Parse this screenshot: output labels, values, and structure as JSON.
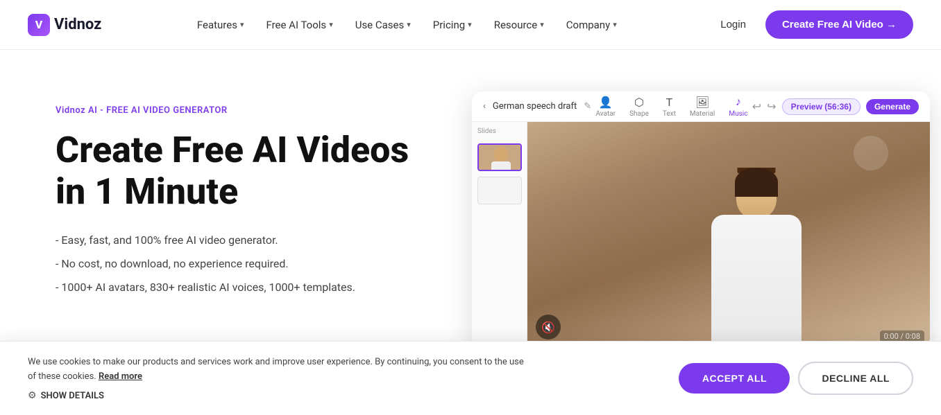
{
  "brand": {
    "name": "Vidnoz",
    "logo_letter": "V"
  },
  "nav": {
    "links": [
      {
        "label": "Features",
        "has_dropdown": true
      },
      {
        "label": "Free AI Tools",
        "has_dropdown": true
      },
      {
        "label": "Use Cases",
        "has_dropdown": true
      },
      {
        "label": "Pricing",
        "has_dropdown": true
      },
      {
        "label": "Resource",
        "has_dropdown": true
      },
      {
        "label": "Company",
        "has_dropdown": true
      }
    ],
    "login_label": "Login",
    "cta_label": "Create Free AI Video →"
  },
  "hero": {
    "badge": "Vidnoz AI - FREE AI VIDEO GENERATOR",
    "title_line1": "Create Free AI Videos",
    "title_line2": "in 1 Minute",
    "bullets": [
      "- Easy, fast, and 100% free AI video generator.",
      "- No cost, no download, no experience required.",
      "- 1000+ AI avatars, 830+ realistic AI voices, 1000+ templates."
    ]
  },
  "preview": {
    "back_label": "‹",
    "draft_title": "German speech draft",
    "edit_icon": "✎",
    "tools": [
      {
        "label": "Avatar",
        "icon": "👤"
      },
      {
        "label": "Shape",
        "icon": "⬡"
      },
      {
        "label": "Text",
        "icon": "T"
      },
      {
        "label": "Material",
        "icon": "🖼"
      },
      {
        "label": "Music",
        "icon": "♪"
      }
    ],
    "preview_btn": "Preview (56:36)",
    "generate_btn": "Generate",
    "slides_label": "Slides"
  },
  "cookie": {
    "text": "We use cookies to make our products and services work and improve user experience. By continuing, you consent to the use of these cookies.",
    "read_more_label": "Read more",
    "show_details_label": "SHOW DETAILS",
    "accept_label": "ACCEPT ALL",
    "decline_label": "DECLINE ALL"
  }
}
